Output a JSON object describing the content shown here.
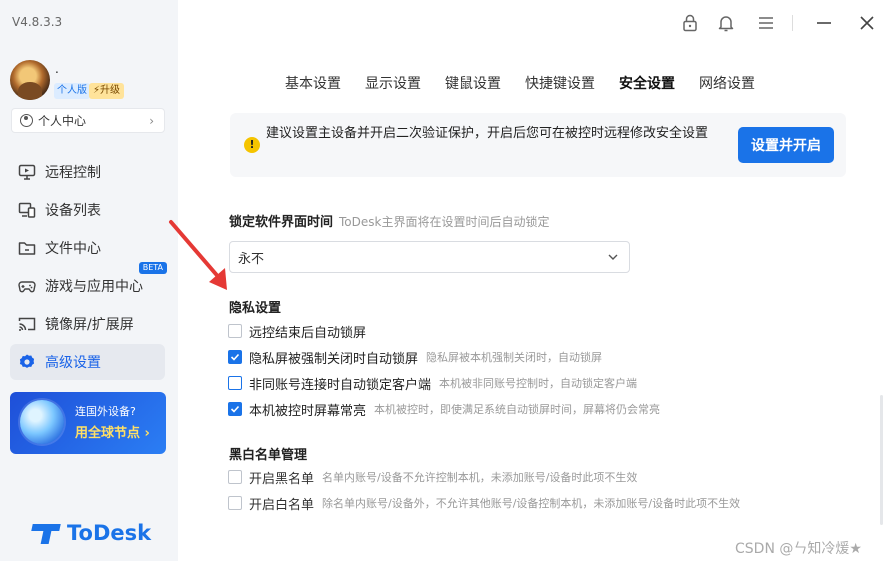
{
  "app": {
    "version": "V4.8.3.3"
  },
  "user": {
    "name": ".",
    "edition_badge": "个人版",
    "upgrade_label": "升级",
    "personal_center_label": "个人中心"
  },
  "sidebar": {
    "items": [
      {
        "label": "远程控制",
        "icon": "monitor-icon"
      },
      {
        "label": "设备列表",
        "icon": "devices-icon"
      },
      {
        "label": "文件中心",
        "icon": "folder-icon"
      },
      {
        "label": "游戏与应用中心",
        "icon": "gamepad-icon",
        "badge": "BETA"
      },
      {
        "label": "镜像屏/扩展屏",
        "icon": "cast-screen-icon"
      },
      {
        "label": "高级设置",
        "icon": "gear-icon",
        "active": true
      }
    ],
    "promo": {
      "line1": "连国外设备?",
      "line2": "用全球节点 ›"
    },
    "logo_text": "ToDesk"
  },
  "tabs": [
    {
      "label": "基本设置"
    },
    {
      "label": "显示设置"
    },
    {
      "label": "键鼠设置"
    },
    {
      "label": "快捷键设置"
    },
    {
      "label": "安全设置",
      "active": true
    },
    {
      "label": "网络设置"
    }
  ],
  "notice": {
    "text": "建议设置主设备并开启二次验证保护，开启后您可在被控时远程修改安全设置",
    "button_label": "设置并开启"
  },
  "lock_time": {
    "title": "锁定软件界面时间",
    "hint": "ToDesk主界面将在设置时间后自动锁定",
    "selected": "永不"
  },
  "privacy": {
    "title": "隐私设置",
    "options": [
      {
        "label": "远控结束后自动锁屏",
        "hint": "",
        "checked": false
      },
      {
        "label": "隐私屏被强制关闭时自动锁屏",
        "hint": "隐私屏被本机强制关闭时，自动锁屏",
        "checked": true
      },
      {
        "label": "非同账号连接时自动锁定客户端",
        "hint": "本机被非同账号控制时，自动锁定客户端",
        "checked": false
      },
      {
        "label": "本机被控时屏幕常亮",
        "hint": "本机被控时，即使满足系统自动锁屏时间，屏幕将仍会常亮",
        "checked": true
      }
    ]
  },
  "blacklist": {
    "title": "黑白名单管理",
    "options": [
      {
        "label": "开启黑名单",
        "hint": "名单内账号/设备不允许控制本机，未添加账号/设备时此项不生效",
        "checked": false
      },
      {
        "label": "开启白名单",
        "hint": "除名单内账号/设备外，不允许其他账号/设备控制本机，未添加账号/设备时此项不生效",
        "checked": false
      }
    ]
  },
  "watermark": "CSDN @ㄣ知冷煖★",
  "colors": {
    "accent": "#1a73e8",
    "annotation_arrow": "#e53935",
    "warning": "#f5c400"
  }
}
